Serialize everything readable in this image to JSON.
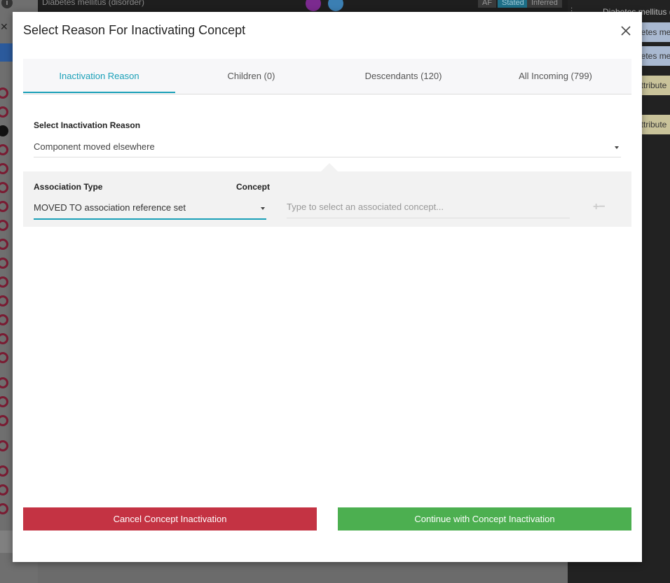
{
  "background": {
    "concept_title": "Diabetes mellitus (disorder)",
    "pills": [
      "AF",
      "Stated",
      "Inferred"
    ],
    "right_header": "Diabetes mellitus (",
    "right_cards": [
      "betes me",
      "betes me",
      "attribute",
      "attribute"
    ]
  },
  "modal": {
    "title": "Select Reason For Inactivating Concept",
    "tabs": [
      {
        "label": "Inactivation Reason",
        "active": true
      },
      {
        "label": "Children (0)",
        "active": false
      },
      {
        "label": "Descendants (120)",
        "active": false
      },
      {
        "label": "All Incoming (799)",
        "active": false
      }
    ],
    "reason": {
      "label": "Select Inactivation Reason",
      "value": "Component moved elsewhere"
    },
    "association": {
      "type_label": "Association Type",
      "concept_label": "Concept",
      "type_value": "MOVED TO association reference set",
      "concept_placeholder": "Type to select an associated concept...",
      "add_remove": "+−"
    },
    "buttons": {
      "cancel": "Cancel Concept Inactivation",
      "continue": "Continue with Concept Inactivation"
    }
  },
  "colors": {
    "accent": "#1aa0b8",
    "cancel": "#c43343",
    "continue": "#4caf50"
  }
}
